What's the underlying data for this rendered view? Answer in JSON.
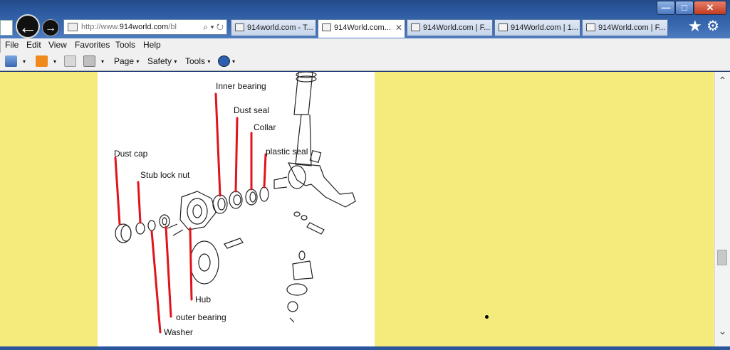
{
  "window": {
    "minimize_glyph": "—",
    "maximize_glyph": "□",
    "close_glyph": "✕"
  },
  "nav": {
    "back_glyph": "←",
    "forward_glyph": "→"
  },
  "address": {
    "prefix": "http://www.",
    "domain": "914world.com",
    "suffix": "/bl",
    "icons": "⌕ ▾ ↻"
  },
  "tabs": [
    {
      "label": "914world.com - T..."
    },
    {
      "label": "914World.com...",
      "close": "✕"
    },
    {
      "label": "914World.com | F..."
    },
    {
      "label": "914World.com | 1..."
    },
    {
      "label": "914World.com | F..."
    }
  ],
  "toolbar_right": {
    "favorites_glyph": "★",
    "tools_glyph": "⚙"
  },
  "menu": [
    "File",
    "Edit",
    "View",
    "Favorites",
    "Tools",
    "Help"
  ],
  "commands": {
    "page": "Page",
    "safety": "Safety",
    "tools": "Tools",
    "dropdown_glyph": "▾"
  },
  "diagram_labels": {
    "inner_bearing": "Inner bearing",
    "dust_seal": "Dust seal",
    "collar": "Collar",
    "plastic_seal": "plastic seal",
    "dust_cap": "Dust cap",
    "stub_lock_nut": "Stub lock nut",
    "hub": "Hub",
    "outer_bearing": "outer bearing",
    "washer": "Washer"
  },
  "scrollbar": {
    "up_glyph": "⌃",
    "down_glyph": "⌄"
  },
  "colors": {
    "page_background": "#f5eb7c",
    "annotation_line": "#e0141c"
  }
}
